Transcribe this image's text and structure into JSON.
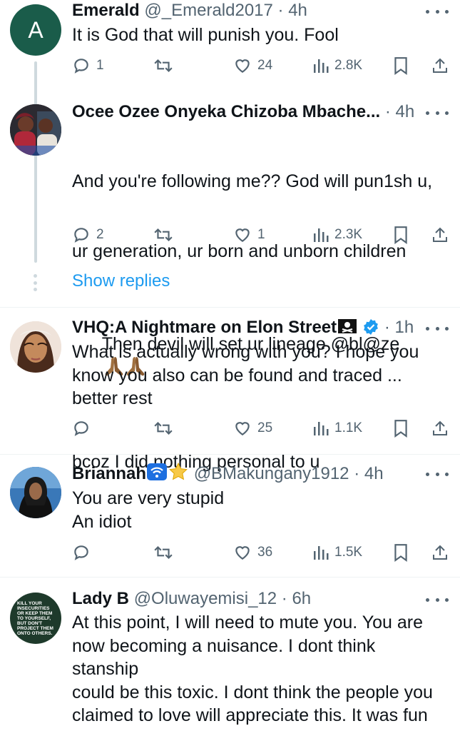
{
  "tweets": [
    {
      "avatar_letter": "A",
      "avatar_color": "#1a5c4a",
      "name": "Emerald",
      "handle": "@_Emerald2017",
      "time": "· 4h",
      "text": "It is God that will punish you. Fool",
      "replies": "1",
      "likes": "24",
      "views": "2.8K"
    },
    {
      "name": "Ocee Ozee Onyeka Chizoba Mbache...",
      "time": "· 4h",
      "text_lines": [
        "And you're following me?? God will pun1sh u,",
        "ur generation, ur born and unborn children",
        "Then devil will set ur lineage @bl@ze",
        "bcoz I did nothing personal to u"
      ],
      "replies": "2",
      "likes": "1",
      "views": "2.3K"
    },
    {
      "name": "VHQ:A Nightmare on Elon Street",
      "time": "· 1h",
      "text": "What is actually wrong with you? I hope you\nknow you also can be found and traced ...\nbetter rest",
      "likes": "25",
      "views": "1.1K"
    },
    {
      "name": "Briannah",
      "handle": "@BMakungany1912",
      "time": "· 4h",
      "text": "You are very stupid\nAn idiot",
      "likes": "36",
      "views": "1.5K"
    },
    {
      "name": "Lady B",
      "handle": "@Oluwayemisi_12",
      "time": "· 6h",
      "avatar_text": "KILL YOUR INSECURITIES OR KEEP THEM TO YOURSELF, BUT DON'T PROJECT THEM ONTO OTHERS.",
      "text": "At this point, I will need to mute you. You are\nnow becoming a nuisance. I dont think stanship\ncould be this toxic. I dont think the people you\nclaimed to love will appreciate this. It was fun\nat first but it is becoming toxic and dangerous. I"
    }
  ],
  "show_replies": "Show replies",
  "colors": {
    "accent": "#1d9bf0",
    "muted": "#536471",
    "text": "#0f1419",
    "thread_line": "#cfd9de"
  },
  "icons": [
    "reply-icon",
    "retweet-icon",
    "like-icon",
    "views-icon",
    "bookmark-icon",
    "share-icon",
    "more-icon",
    "verified-icon"
  ]
}
